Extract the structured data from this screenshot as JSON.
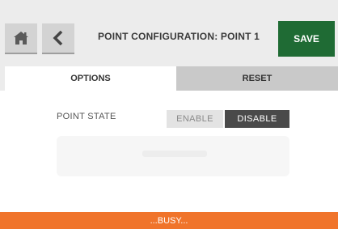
{
  "header": {
    "title": "POINT CONFIGURATION: POINT 1",
    "save_label": "SAVE",
    "home_icon": "home-icon",
    "back_icon": "chevron-left-icon"
  },
  "tabs": [
    {
      "label": "OPTIONS",
      "active": true
    },
    {
      "label": "RESET",
      "active": false
    }
  ],
  "point_state": {
    "label": "POINT STATE",
    "options": [
      "ENABLE",
      "DISABLE"
    ],
    "selected": "DISABLE"
  },
  "status": {
    "text": "...BUSY..."
  },
  "colors": {
    "save": "#1f6b34",
    "busy": "#f0742b",
    "selected_toggle": "#4a4a4a",
    "tab_inactive": "#c9c9c9"
  }
}
